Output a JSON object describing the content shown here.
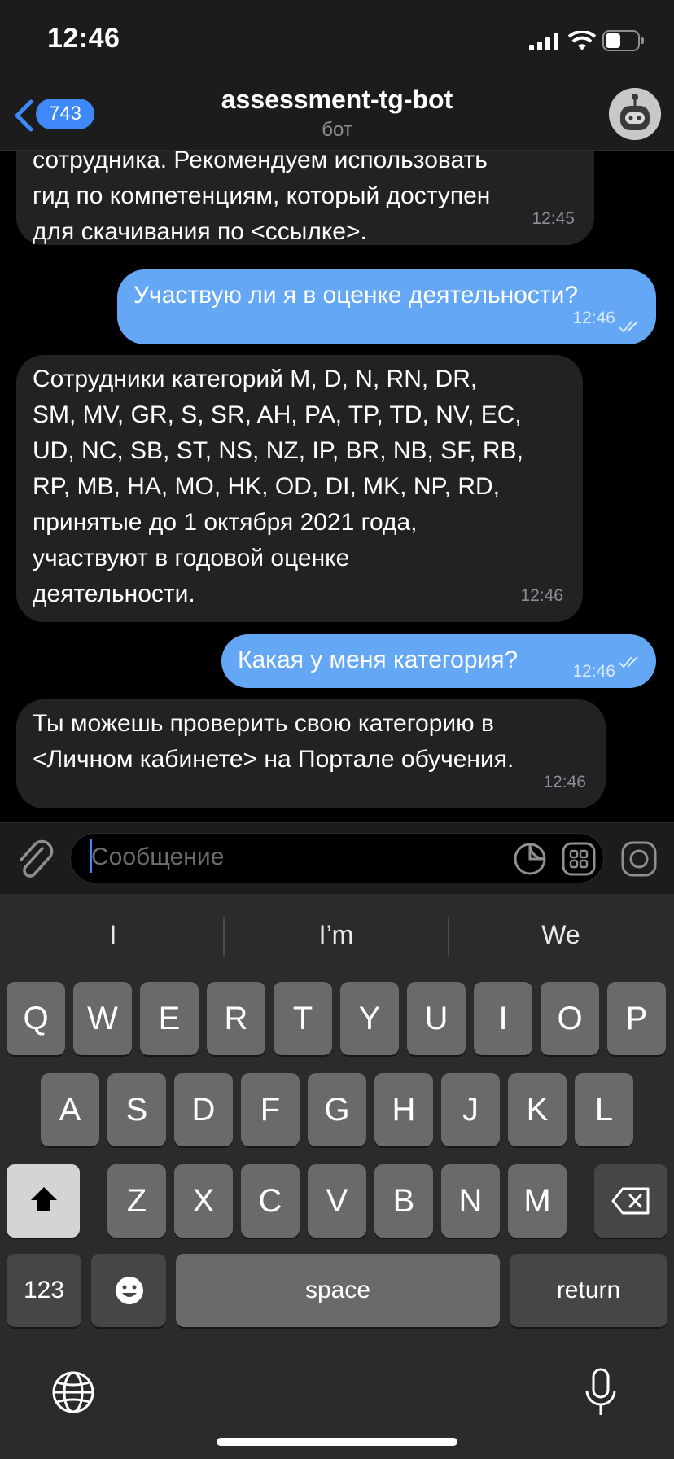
{
  "status_bar": {
    "time": "12:46"
  },
  "header": {
    "back_count": "743",
    "title": "assessment-tg-bot",
    "subtitle": "бот"
  },
  "messages": [
    {
      "direction": "incoming",
      "text": "сотрудника. Рекомендуем использовать\nгид по компетенциям, который доступен\nдля скачивания по <ссылке>.",
      "time": "12:45"
    },
    {
      "direction": "outgoing",
      "text": "Участвую ли я в оценке деятельности?",
      "time": "12:46",
      "read": true
    },
    {
      "direction": "incoming",
      "text": "Сотрудники категорий M, D, N, RN, DR,\nSM, MV, GR, S, SR, AH, PA, TP, TD, NV, EC,\nUD, NC, SB, ST, NS, NZ, IP, BR, NB, SF, RB,\nRP, MB, HA, MO, HK, OD, DI, MK, NP, RD,\nпринятые до 1 октября 2021 года,\nучаствуют в годовой оценке\nдеятельности.",
      "time": "12:46"
    },
    {
      "direction": "outgoing",
      "text": "Какая у меня категория?",
      "time": "12:46",
      "read": true
    },
    {
      "direction": "incoming",
      "text": "Ты можешь проверить свою категорию в\n<Личном кабинете> на Портале обучения.",
      "time": "12:46"
    }
  ],
  "composer": {
    "placeholder": "Сообщение"
  },
  "keyboard": {
    "suggestions": [
      "I",
      "I’m",
      "We"
    ],
    "row1": [
      "Q",
      "W",
      "E",
      "R",
      "T",
      "Y",
      "U",
      "I",
      "O",
      "P"
    ],
    "row2": [
      "A",
      "S",
      "D",
      "F",
      "G",
      "H",
      "J",
      "K",
      "L"
    ],
    "row3": [
      "Z",
      "X",
      "C",
      "V",
      "B",
      "N",
      "M"
    ],
    "numbers_label": "123",
    "space_label": "space",
    "return_label": "return"
  },
  "colors": {
    "accent": "#3e88f7",
    "outgoing_bubble": "#64a8f5",
    "incoming_bubble": "#222224"
  }
}
